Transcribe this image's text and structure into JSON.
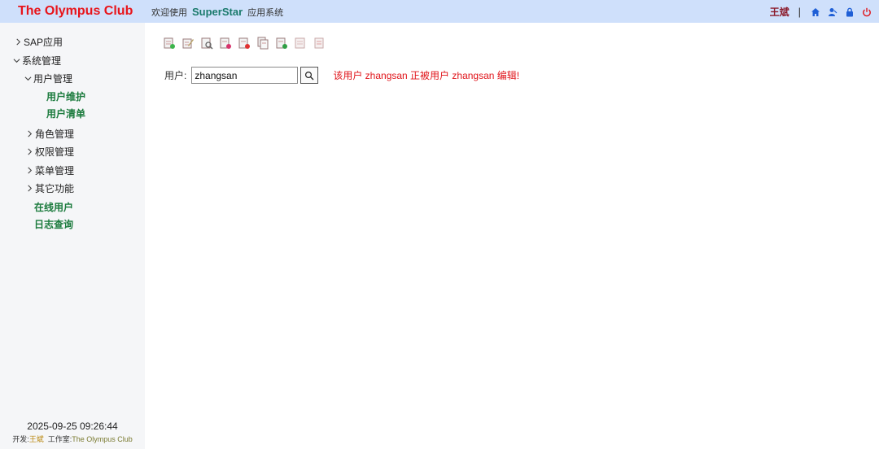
{
  "header": {
    "brand": "The Olympus Club",
    "welcome_prefix": "欢迎使用",
    "system_name": "SuperStar",
    "welcome_suffix": "应用系统",
    "user_name": "王斌",
    "separator": "|",
    "icons": [
      "home-icon",
      "user-profile-icon",
      "lock-icon",
      "power-icon"
    ],
    "icon_color": "#1f5fd6",
    "power_color": "#e0141a"
  },
  "sidebar": {
    "items": [
      {
        "label": "SAP应用",
        "state": "collapsed"
      },
      {
        "label": "系统管理",
        "state": "expanded"
      },
      {
        "label": "用户管理",
        "state": "expanded"
      },
      {
        "label": "用户维护"
      },
      {
        "label": "用户清单"
      },
      {
        "label": "角色管理",
        "state": "collapsed"
      },
      {
        "label": "权限管理",
        "state": "collapsed"
      },
      {
        "label": "菜单管理",
        "state": "collapsed"
      },
      {
        "label": "其它功能",
        "state": "collapsed"
      },
      {
        "label": "在线用户"
      },
      {
        "label": "日志查询"
      }
    ],
    "footer": {
      "datetime": "2025-09-25 09:26:44",
      "dev_label": "开发:",
      "dev_name": "王斌",
      "studio_label": "工作室:",
      "studio_name": "The Olympus Club"
    }
  },
  "toolbar": {
    "icons": [
      "create-icon",
      "edit-icon",
      "display-icon",
      "delete-icon",
      "lock-user-icon",
      "copy-icon",
      "unlock-user-icon",
      "change-log-icon",
      "print-icon"
    ]
  },
  "main": {
    "user_label": "用户:",
    "user_value": "zhangsan",
    "message": "该用户 zhangsan 正被用户 zhangsan 编辑!",
    "message_color": "#e0141a"
  },
  "colors": {
    "header_bg": "#cfe0fb",
    "brand": "#e8141a",
    "sidebar_bg": "#f5f6f8",
    "leaf_green": "#1a7a3c"
  }
}
